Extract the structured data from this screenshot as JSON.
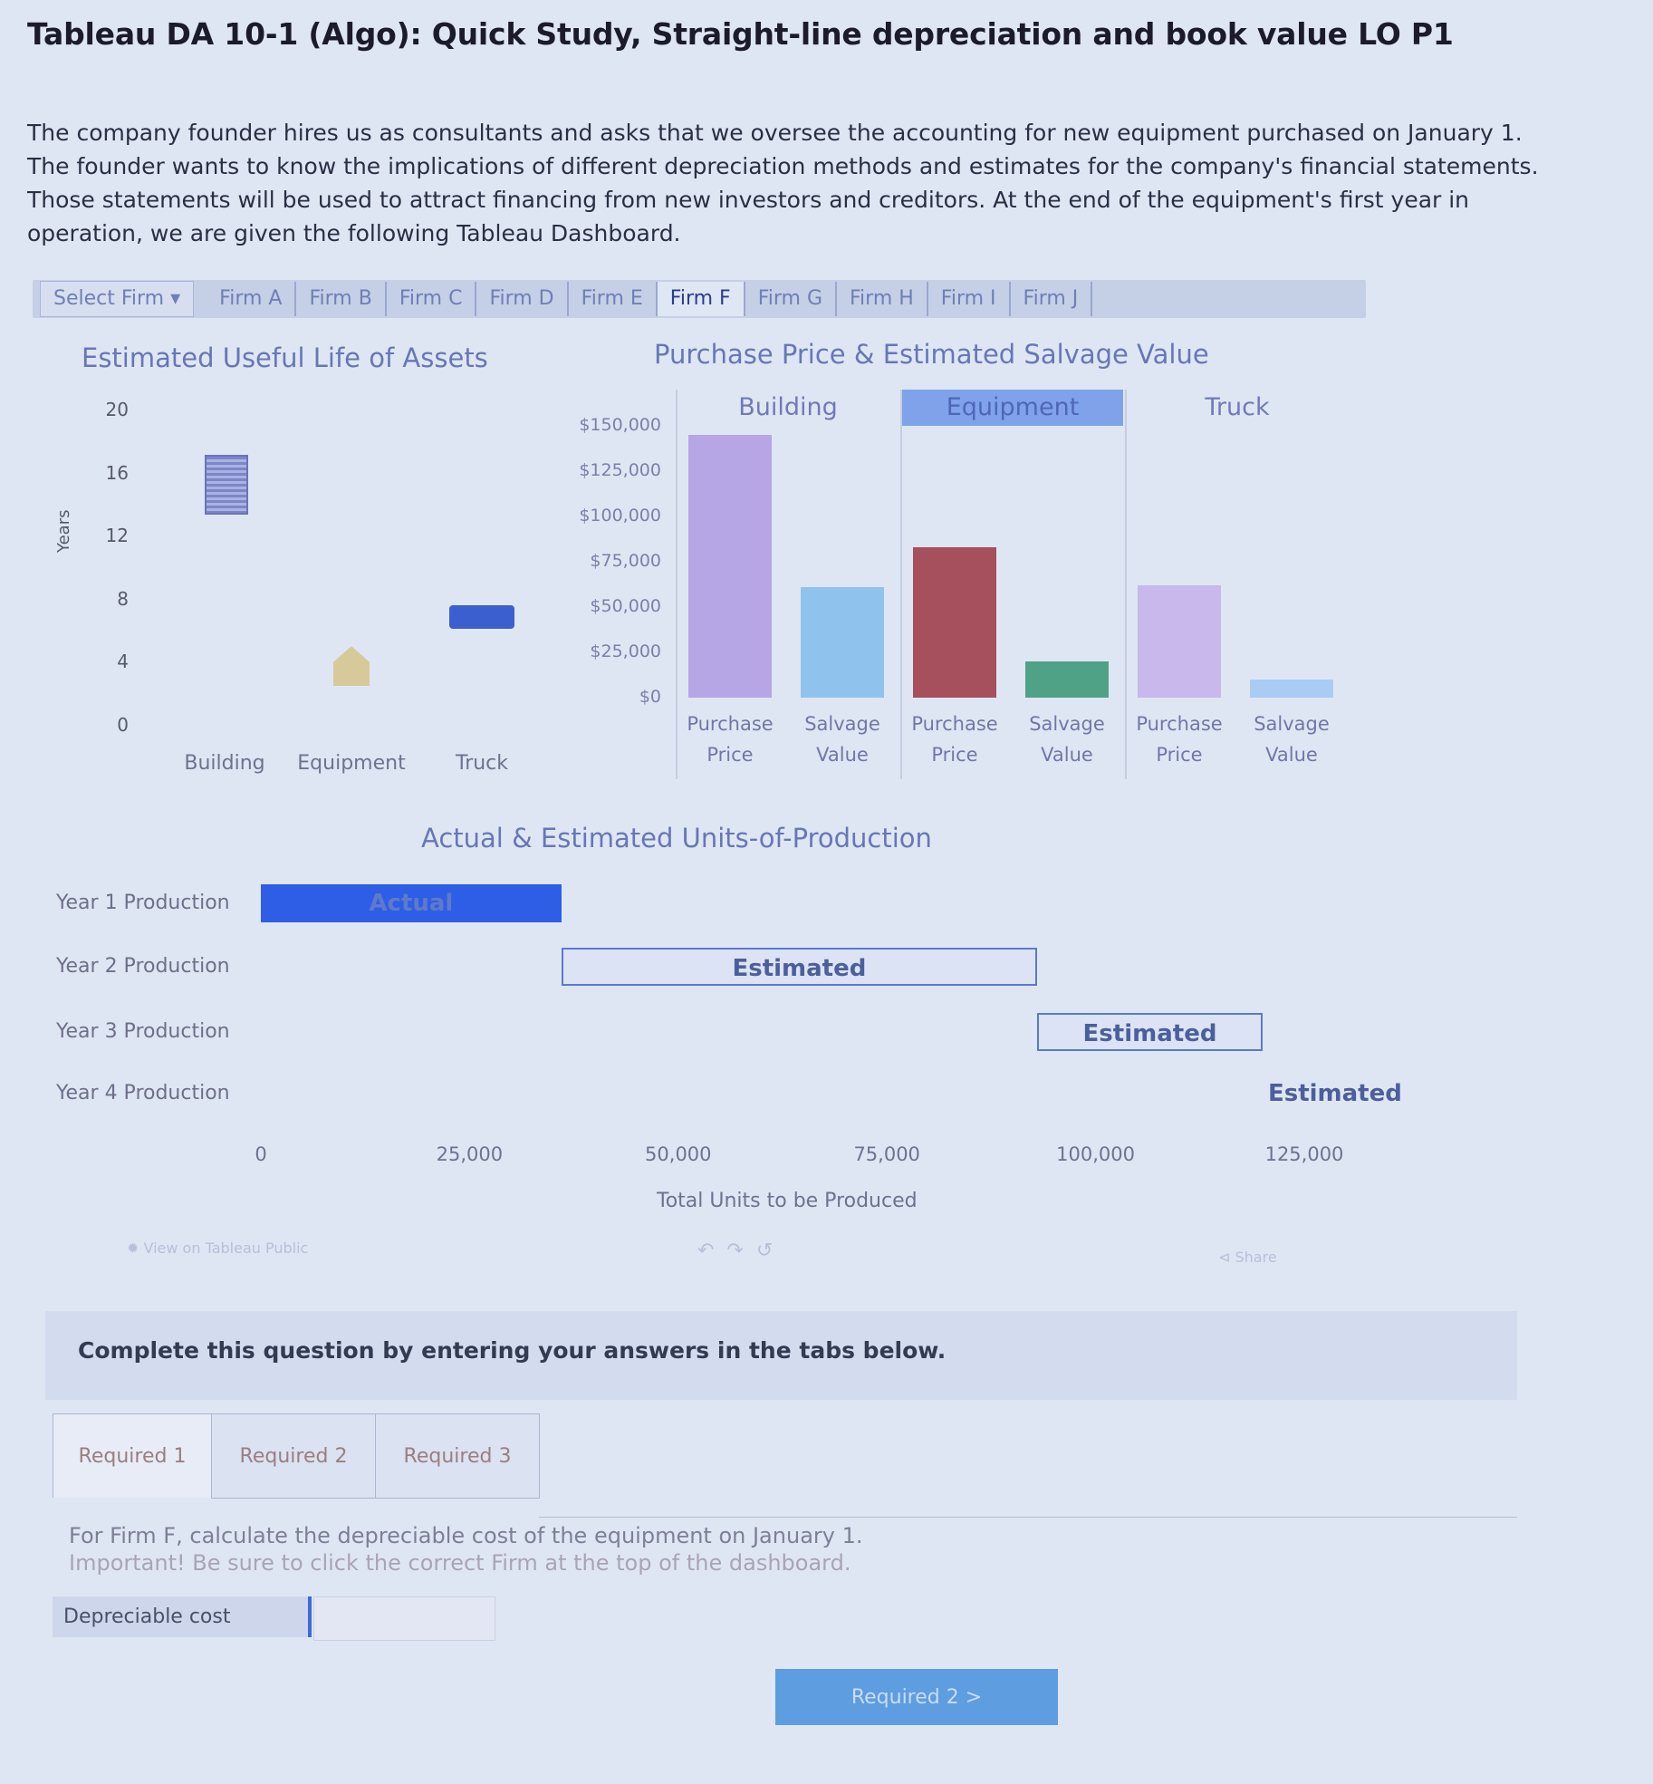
{
  "title": "Tableau DA 10-1 (Algo): Quick Study, Straight-line depreciation and book value LO P1",
  "intro": [
    "The company founder hires us as consultants and asks that we oversee the accounting for new equipment purchased on January 1.",
    "The founder wants to know the implications of different depreciation methods and estimates for the company's financial statements.",
    "Those statements will be used to attract financing from new investors and creditors. At the end of the equipment's first year in",
    "operation, we are given the following Tableau Dashboard."
  ],
  "firm_bar": {
    "select_label": "Select Firm",
    "firms": [
      "Firm A",
      "Firm B",
      "Firm C",
      "Firm D",
      "Firm E",
      "Firm F",
      "Firm G",
      "Firm H",
      "Firm I",
      "Firm J"
    ],
    "active": "Firm F"
  },
  "useful_life": {
    "title": "Estimated Useful Life of Assets",
    "ylabel": "Years",
    "yticks": [
      "20",
      "16",
      "12",
      "8",
      "4",
      "0"
    ],
    "categories": [
      "Building",
      "Equipment",
      "Truck"
    ]
  },
  "purchase": {
    "title": "Purchase Price & Estimated Salvage Value",
    "panels": [
      "Building",
      "Equipment",
      "Truck"
    ],
    "yticks": [
      "$150,000",
      "$125,000",
      "$100,000",
      "$75,000",
      "$50,000",
      "$25,000",
      "$0"
    ],
    "bar_labels": [
      [
        "Purchase",
        "Price"
      ],
      [
        "Salvage",
        "Value"
      ],
      [
        "Purchase",
        "Price"
      ],
      [
        "Salvage",
        "Value"
      ],
      [
        "Purchase",
        "Price"
      ],
      [
        "Salvage",
        "Value"
      ]
    ]
  },
  "units": {
    "title": "Actual & Estimated Units-of-Production",
    "rows": [
      "Year 1 Production",
      "Year 2 Production",
      "Year 3 Production",
      "Year 4 Production"
    ],
    "bar_texts": [
      "Actual",
      "Estimated",
      "Estimated",
      "Estimated"
    ],
    "xticks": [
      "0",
      "25,000",
      "50,000",
      "75,000",
      "100,000",
      "125,000"
    ],
    "xlabel": "Total Units to be Produced"
  },
  "toolbar": {
    "view_label": "View on Tableau Public",
    "share_label": "Share"
  },
  "chart_data": [
    {
      "type": "scatter",
      "title": "Estimated Useful Life of Assets",
      "ylabel": "Years",
      "ylim": [
        0,
        20
      ],
      "categories": [
        "Building",
        "Equipment",
        "Truck"
      ],
      "values": [
        15,
        3.5,
        7
      ]
    },
    {
      "type": "bar",
      "title": "Purchase Price & Estimated Salvage Value",
      "ylim": [
        0,
        150000
      ],
      "panels": [
        "Building",
        "Equipment",
        "Truck"
      ],
      "categories": [
        "Purchase Price",
        "Salvage Value"
      ],
      "series": [
        {
          "name": "Building",
          "values": [
            145000,
            61000
          ]
        },
        {
          "name": "Equipment",
          "values": [
            83000,
            20000
          ]
        },
        {
          "name": "Truck",
          "values": [
            62000,
            10000
          ]
        }
      ],
      "colors": [
        "#b6a6e6",
        "#90c2ee",
        "#a64f5d",
        "#4fa286",
        "#c8b8ec",
        "#a8ccf3"
      ]
    },
    {
      "type": "bar",
      "title": "Actual & Estimated Units-of-Production",
      "xlabel": "Total Units to be Produced",
      "xlim": [
        0,
        125000
      ],
      "categories": [
        "Year 1 Production",
        "Year 2 Production",
        "Year 3 Production",
        "Year 4 Production"
      ],
      "ranges": [
        [
          0,
          36000
        ],
        [
          36000,
          93000
        ],
        [
          93000,
          120000
        ],
        [
          120000,
          125000
        ]
      ],
      "labels": [
        "Actual",
        "Estimated",
        "Estimated",
        "Estimated"
      ]
    }
  ],
  "question": {
    "complete_text": "Complete this question by entering your answers in the tabs below.",
    "tabs": [
      "Required 1",
      "Required 2",
      "Required 3"
    ],
    "instruction": "For Firm F, calculate the depreciable cost of the equipment on January 1.",
    "important": "Important! Be sure to click the correct Firm at the top of the dashboard.",
    "depreciable_label": "Depreciable cost",
    "depreciable_value": "",
    "next_button": "Required 2  >"
  }
}
